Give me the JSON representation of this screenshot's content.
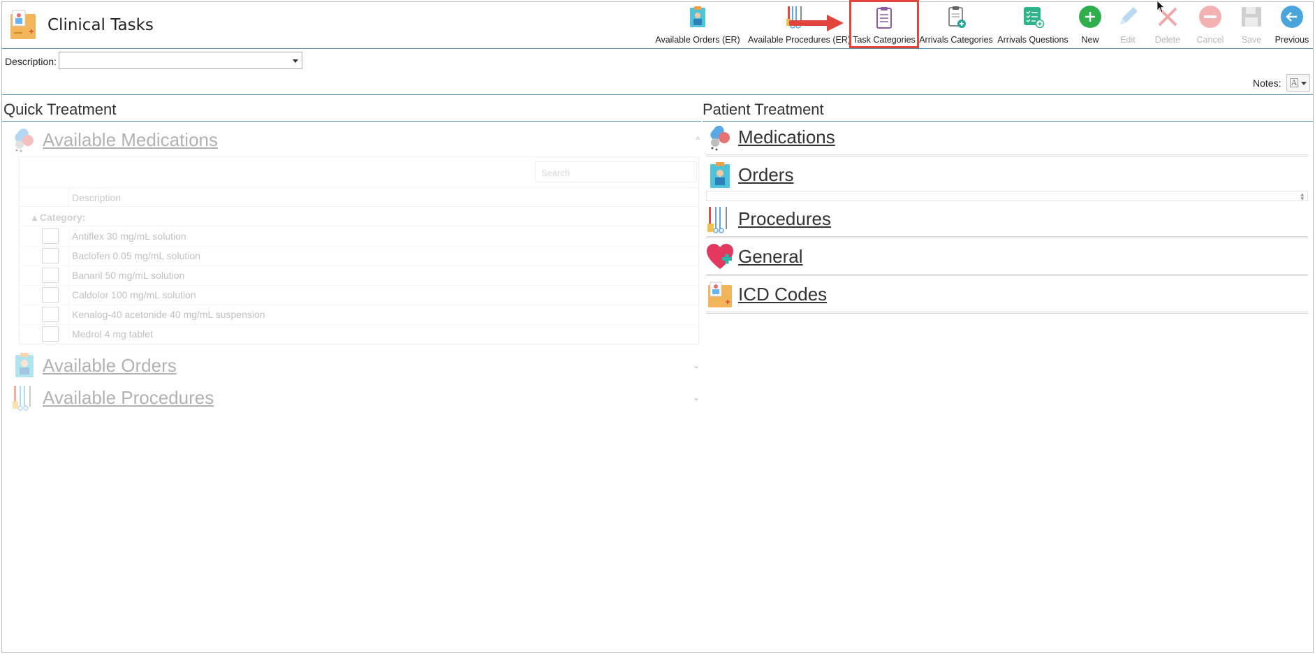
{
  "app": {
    "title": "Clinical Tasks"
  },
  "toolbar": {
    "available_orders_er": "Available Orders (ER)",
    "available_procedures_er": "Available Procedures (ER)",
    "task_categories": "Task Categories",
    "arrivals_categories": "Arrivals Categories",
    "arrivals_questions": "Arrivals Questions",
    "new": "New",
    "edit": "Edit",
    "delete": "Delete",
    "cancel": "Cancel",
    "save": "Save",
    "previous": "Previous"
  },
  "description": {
    "label": "Description:",
    "value": ""
  },
  "notes": {
    "label": "Notes:"
  },
  "quick_treatment": {
    "title": "Quick Treatment",
    "available_medications": "Available Medications",
    "available_orders": "Available Orders",
    "available_procedures": "Available Procedures",
    "grid": {
      "search_placeholder": "Search",
      "column_description": "Description",
      "group_label": "Category:",
      "rows": [
        "Antiflex 30 mg/mL solution",
        "Baclofen 0.05 mg/mL solution",
        "Banaril 50 mg/mL solution",
        "Caldolor 100 mg/mL solution",
        "Kenalog-40 acetonide 40 mg/mL suspension",
        "Medrol 4 mg tablet"
      ]
    }
  },
  "patient_treatment": {
    "title": "Patient Treatment",
    "medications": "Medications",
    "orders": "Orders",
    "procedures": "Procedures",
    "general": "General",
    "icd_codes": "ICD Codes"
  }
}
